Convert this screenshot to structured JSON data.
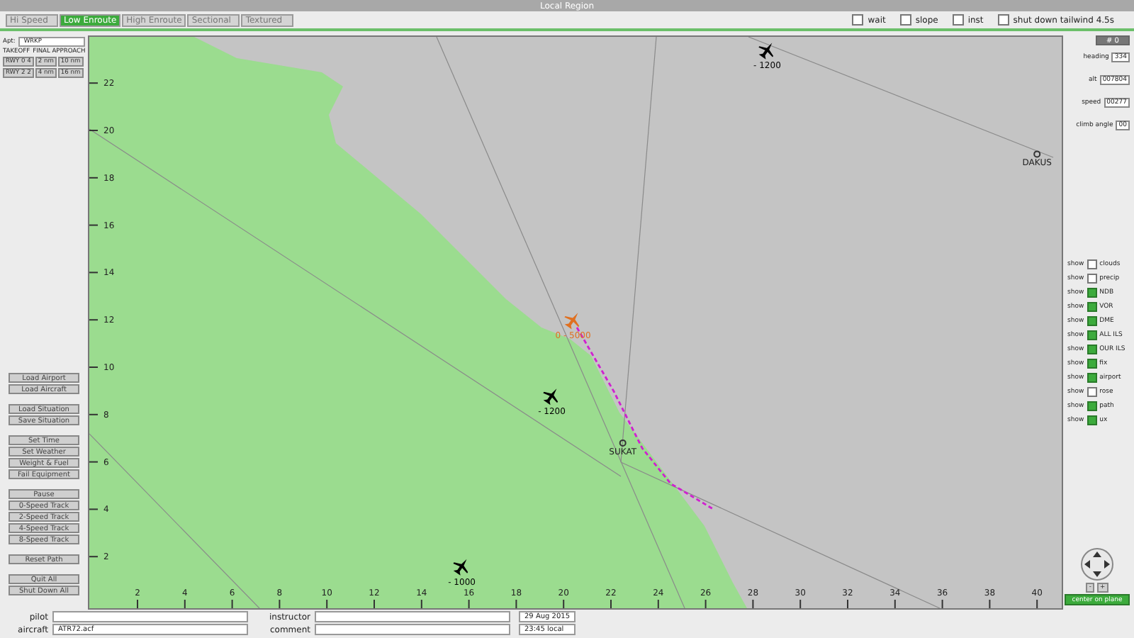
{
  "window": {
    "title": "Local Region"
  },
  "tabs": [
    {
      "label": "Hi Speed",
      "selected": false
    },
    {
      "label": "Low Enroute",
      "selected": true
    },
    {
      "label": "High Enroute",
      "selected": false
    },
    {
      "label": "Sectional",
      "selected": false
    },
    {
      "label": "Textured",
      "selected": false
    }
  ],
  "toggles": [
    {
      "label": "wait",
      "checked": false
    },
    {
      "label": "slope",
      "checked": false
    },
    {
      "label": "inst",
      "checked": false
    },
    {
      "label": "shut down tailwind 4.5s",
      "checked": false
    }
  ],
  "left_panel": {
    "airport_label": "Apt:",
    "airport": "WRKP",
    "takeoff_label": "TAKEOFF",
    "approach_label": "FINAL APPROACH",
    "runway_buttons": [
      [
        "RWY 0 4",
        "2 nm",
        "10 nm"
      ],
      [
        "RWY 2 2",
        "4 nm",
        "16 nm"
      ]
    ],
    "button_groups": [
      [
        "Load Airport",
        "Load Aircraft"
      ],
      [
        "Load Situation",
        "Save Situation"
      ],
      [
        "Set Time",
        "Set Weather",
        "Weight & Fuel",
        "Fail Equipment"
      ],
      [
        "Pause",
        "0-Speed Track",
        "2-Speed Track",
        "4-Speed Track",
        "8-Speed Track"
      ],
      [
        "Reset Path"
      ],
      [
        "Quit All",
        "Shut Down All"
      ]
    ]
  },
  "map": {
    "xticks": [
      "2",
      "4",
      "6",
      "8",
      "10",
      "12",
      "14",
      "16",
      "18",
      "20",
      "22",
      "24",
      "26",
      "28",
      "30",
      "32",
      "34",
      "36",
      "38",
      "40"
    ],
    "yticks": [
      "22",
      "20",
      "18",
      "16",
      "14",
      "12",
      "10",
      "8",
      "6",
      "4",
      "2"
    ],
    "aircraft": [
      {
        "label": "- 1200"
      },
      {
        "label": "- 1200"
      },
      {
        "label": "- 1000"
      },
      {
        "label": "0 - 5000"
      }
    ],
    "waypoints": [
      {
        "label": "SUKAT"
      },
      {
        "label": "DAKUS"
      }
    ]
  },
  "right_panel": {
    "tabs": [
      {
        "label": "# 0",
        "selected": true
      }
    ],
    "instruments": [
      {
        "label": "heading",
        "value": "334"
      },
      {
        "label": "alt",
        "value": "007804"
      },
      {
        "label": "speed",
        "value": "00277"
      },
      {
        "label": "climb angle",
        "value": "00"
      }
    ],
    "layers": [
      {
        "prefix": "show",
        "label": "clouds",
        "checked": false
      },
      {
        "prefix": "show",
        "label": "precip",
        "checked": false
      },
      {
        "prefix": "show",
        "label": "NDB",
        "checked": true
      },
      {
        "prefix": "show",
        "label": "VOR",
        "checked": true
      },
      {
        "prefix": "show",
        "label": "DME",
        "checked": true
      },
      {
        "prefix": "show",
        "label": "ALL ILS",
        "checked": true
      },
      {
        "prefix": "show",
        "label": "OUR ILS",
        "checked": true
      },
      {
        "prefix": "show",
        "label": "fix",
        "checked": true
      },
      {
        "prefix": "show",
        "label": "airport",
        "checked": true
      },
      {
        "prefix": "show",
        "label": "rose",
        "checked": false
      },
      {
        "prefix": "show",
        "label": "path",
        "checked": true
      },
      {
        "prefix": "show",
        "label": "ux",
        "checked": true
      }
    ],
    "zoom_buttons": [
      "-",
      "+"
    ],
    "action_button": "center on plane"
  },
  "bottom": {
    "pilot_label": "pilot",
    "aircraft_label": "aircraft",
    "aircraft": "ATR72.acf",
    "instructor_label": "instructor",
    "comment_label": "comment",
    "date": "29 Aug 2015",
    "time": "23:45 local"
  }
}
